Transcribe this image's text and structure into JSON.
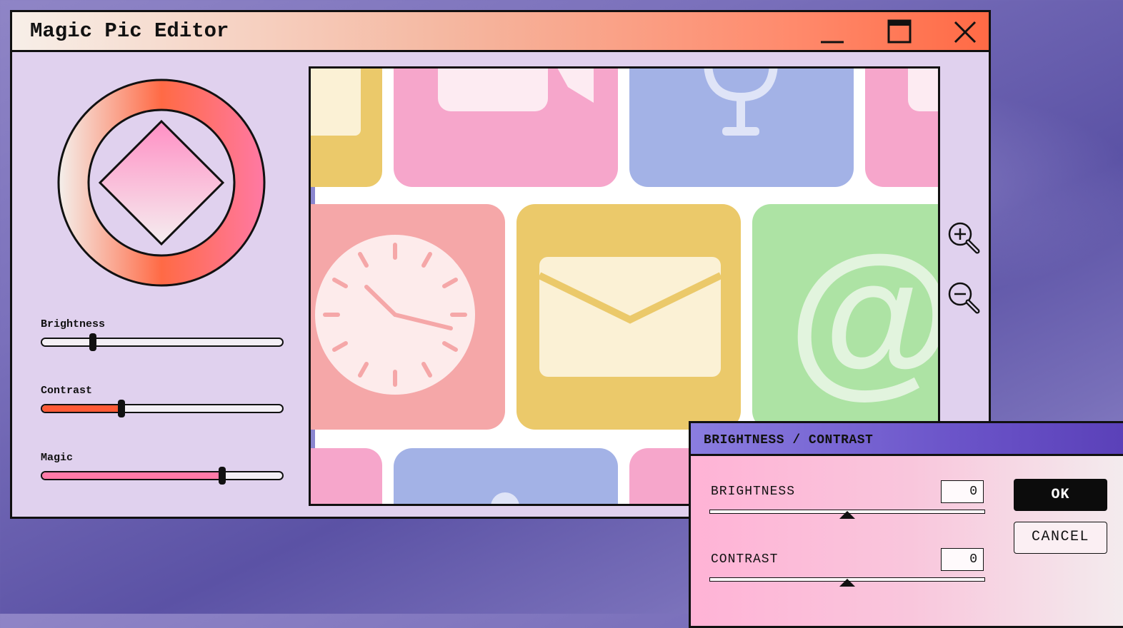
{
  "window": {
    "title": "Magic Pic Editor",
    "controls": {
      "minimize_icon": "minimize-icon",
      "maximize_icon": "maximize-icon",
      "close_icon": "close-icon"
    },
    "titlebar_gradient": [
      "#f7efe8",
      "#ff6a45"
    ],
    "background": "#e0d1ee"
  },
  "left_panel": {
    "color_wheel_icon": "color-wheel-icon",
    "sliders": [
      {
        "label": "Brightness",
        "value": 0.21,
        "fill_color": "#f4f0f4"
      },
      {
        "label": "Contrast",
        "value": 0.33,
        "fill_color": "#ff5a36"
      },
      {
        "label": "Magic",
        "value": 0.75,
        "fill_color": "#ff7aa8"
      }
    ]
  },
  "canvas": {
    "tiles": [
      {
        "icon": "folder-icon",
        "color": "#ebc96a"
      },
      {
        "icon": "chat-bubble-icon",
        "color": "#f6a6cb"
      },
      {
        "icon": "microphone-icon",
        "color": "#a3b2e6"
      },
      {
        "icon": "pink-app-icon",
        "color": "#f6a6cb"
      },
      {
        "icon": "clock-icon",
        "color": "#f5a7a8"
      },
      {
        "icon": "mail-icon",
        "color": "#ebc96a"
      },
      {
        "icon": "at-sign-icon",
        "color": "#ade3a4"
      }
    ],
    "at_symbol": "@",
    "zoom_in_icon": "zoom-in-icon",
    "zoom_out_icon": "zoom-out-icon"
  },
  "dialog": {
    "title": "BRIGHTNESS / CONTRAST",
    "brightness_label": "BRIGHTNESS",
    "brightness_value": "0",
    "brightness_position": 0.5,
    "contrast_label": "CONTRAST",
    "contrast_value": "0",
    "contrast_position": 0.5,
    "ok_label": "OK",
    "cancel_label": "CANCEL"
  }
}
